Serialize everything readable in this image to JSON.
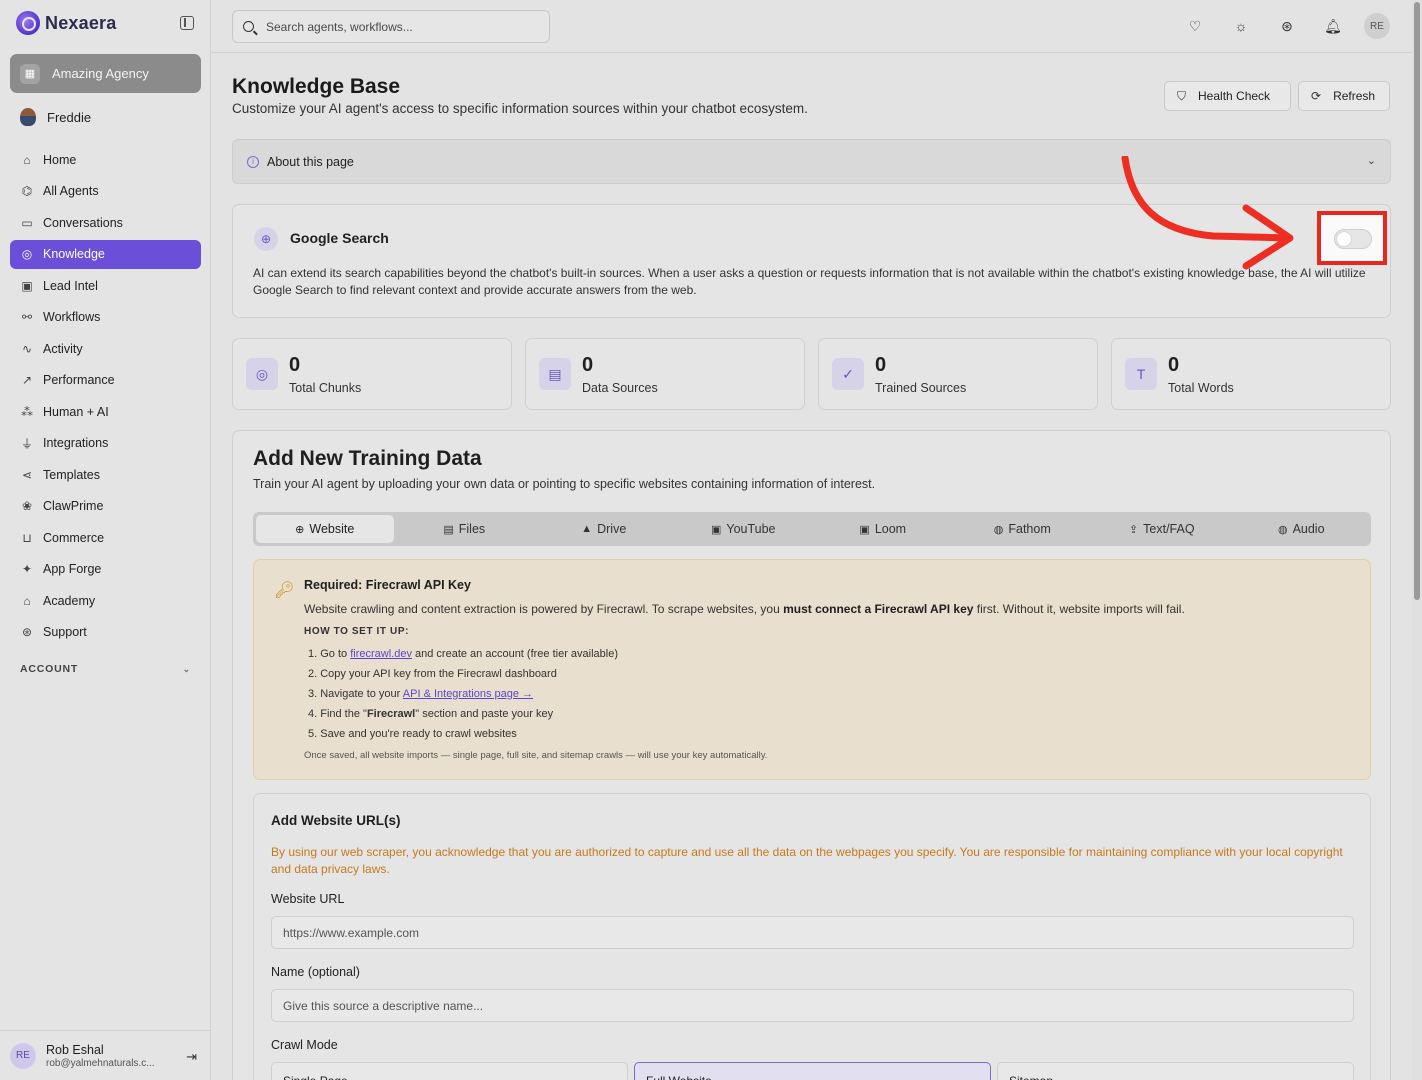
{
  "brand": {
    "name": "Nexaera"
  },
  "sidebar": {
    "agency": "Amazing Agency",
    "user": "Freddie",
    "items": [
      {
        "label": "Home",
        "icon": "home-icon",
        "glyph": "⌂"
      },
      {
        "label": "All Agents",
        "icon": "bot-icon",
        "glyph": "⌬"
      },
      {
        "label": "Conversations",
        "icon": "chat-icon",
        "glyph": "▭"
      },
      {
        "label": "Knowledge",
        "icon": "brain-icon",
        "glyph": "◎"
      },
      {
        "label": "Lead Intel",
        "icon": "contact-icon",
        "glyph": "▣"
      },
      {
        "label": "Workflows",
        "icon": "workflow-icon",
        "glyph": "⚯"
      },
      {
        "label": "Activity",
        "icon": "activity-icon",
        "glyph": "∿"
      },
      {
        "label": "Performance",
        "icon": "trending-icon",
        "glyph": "↗"
      },
      {
        "label": "Human + AI",
        "icon": "network-icon",
        "glyph": "⁂"
      },
      {
        "label": "Integrations",
        "icon": "plug-icon",
        "glyph": "⏚"
      },
      {
        "label": "Templates",
        "icon": "share-icon",
        "glyph": "⋖"
      },
      {
        "label": "ClawPrime",
        "icon": "paw-icon",
        "glyph": "❀"
      },
      {
        "label": "Commerce",
        "icon": "cart-icon",
        "glyph": "⊔"
      },
      {
        "label": "App Forge",
        "icon": "sparkles-icon",
        "glyph": "✦"
      },
      {
        "label": "Academy",
        "icon": "graduation-icon",
        "glyph": "⌂"
      },
      {
        "label": "Support",
        "icon": "lifebuoy-icon",
        "glyph": "⊛"
      }
    ],
    "active_index": 3,
    "account_label": "ACCOUNT",
    "footer": {
      "initials": "RE",
      "name": "Rob Eshal",
      "email": "rob@yalmehnaturals.c..."
    }
  },
  "topbar": {
    "search_placeholder": "Search agents, workflows...",
    "avatar_initials": "RE"
  },
  "page": {
    "title": "Knowledge Base",
    "subtitle": "Customize your AI agent's access to specific information sources within your chatbot ecosystem.",
    "health_check": "Health Check",
    "refresh": "Refresh",
    "about": "About this page"
  },
  "google_search": {
    "title": "Google Search",
    "description": "AI can extend its search capabilities beyond the chatbot's built-in sources. When a user asks a question or requests information that is not available within the chatbot's existing knowledge base, the AI will utilize Google Search to find relevant context and provide accurate answers from the web.",
    "enabled": false
  },
  "stats": [
    {
      "value": "0",
      "label": "Total Chunks",
      "icon": "brain-icon",
      "glyph": "◎"
    },
    {
      "value": "0",
      "label": "Data Sources",
      "icon": "file-icon",
      "glyph": "▤"
    },
    {
      "value": "0",
      "label": "Trained Sources",
      "icon": "check-circle-icon",
      "glyph": "✓"
    },
    {
      "value": "0",
      "label": "Total Words",
      "icon": "type-icon",
      "glyph": "T"
    }
  ],
  "training": {
    "title": "Add New Training Data",
    "subtitle": "Train your AI agent by uploading your own data or pointing to specific websites containing information of interest.",
    "tabs": [
      {
        "label": "Website",
        "icon": "globe-icon",
        "glyph": "⊕"
      },
      {
        "label": "Files",
        "icon": "file-icon",
        "glyph": "▤"
      },
      {
        "label": "Drive",
        "icon": "drive-icon",
        "glyph": "▲"
      },
      {
        "label": "YouTube",
        "icon": "youtube-icon",
        "glyph": "▣"
      },
      {
        "label": "Loom",
        "icon": "loom-icon",
        "glyph": "▣"
      },
      {
        "label": "Fathom",
        "icon": "fathom-icon",
        "glyph": "◍"
      },
      {
        "label": "Text/FAQ",
        "icon": "upload-icon",
        "glyph": "⇪"
      },
      {
        "label": "Audio",
        "icon": "audio-icon",
        "glyph": "◍"
      }
    ],
    "active_tab": 0,
    "firecrawl": {
      "title": "Required: Firecrawl API Key",
      "desc_pre": "Website crawling and content extraction is powered by Firecrawl. To scrape websites, you ",
      "desc_bold": "must connect a Firecrawl API key",
      "desc_post": " first. Without it, website imports will fail.",
      "how_label": "HOW TO SET IT UP:",
      "step1_pre": "1. Go to ",
      "step1_link": "firecrawl.dev",
      "step1_post": " and create an account (free tier available)",
      "step2": "2. Copy your API key from the Firecrawl dashboard",
      "step3_pre": "3. Navigate to your ",
      "step3_link": "API & Integrations page →",
      "step4_pre": "4. Find the \"",
      "step4_bold": "Firecrawl",
      "step4_post": "\" section and paste your key",
      "step5": "5. Save and you're ready to crawl websites",
      "footer": "Once saved, all website imports — single page, full site, and sitemap crawls — will use your key automatically."
    },
    "url_form": {
      "title": "Add Website URL(s)",
      "warning": "By using our web scraper, you acknowledge that you are authorized to capture and use all the data on the webpages you specify. You are responsible for maintaining compliance with your local copyright and data privacy laws.",
      "url_label": "Website URL",
      "url_placeholder": "https://www.example.com",
      "name_label": "Name (optional)",
      "name_placeholder": "Give this source a descriptive name...",
      "crawl_label": "Crawl Mode",
      "modes": [
        "Single Page",
        "Full Website",
        "Sitemap"
      ],
      "selected_mode": 1
    }
  },
  "colors": {
    "accent": "#6b4fd8",
    "highlight": "#e8281f",
    "warning": "#c57a1c"
  }
}
